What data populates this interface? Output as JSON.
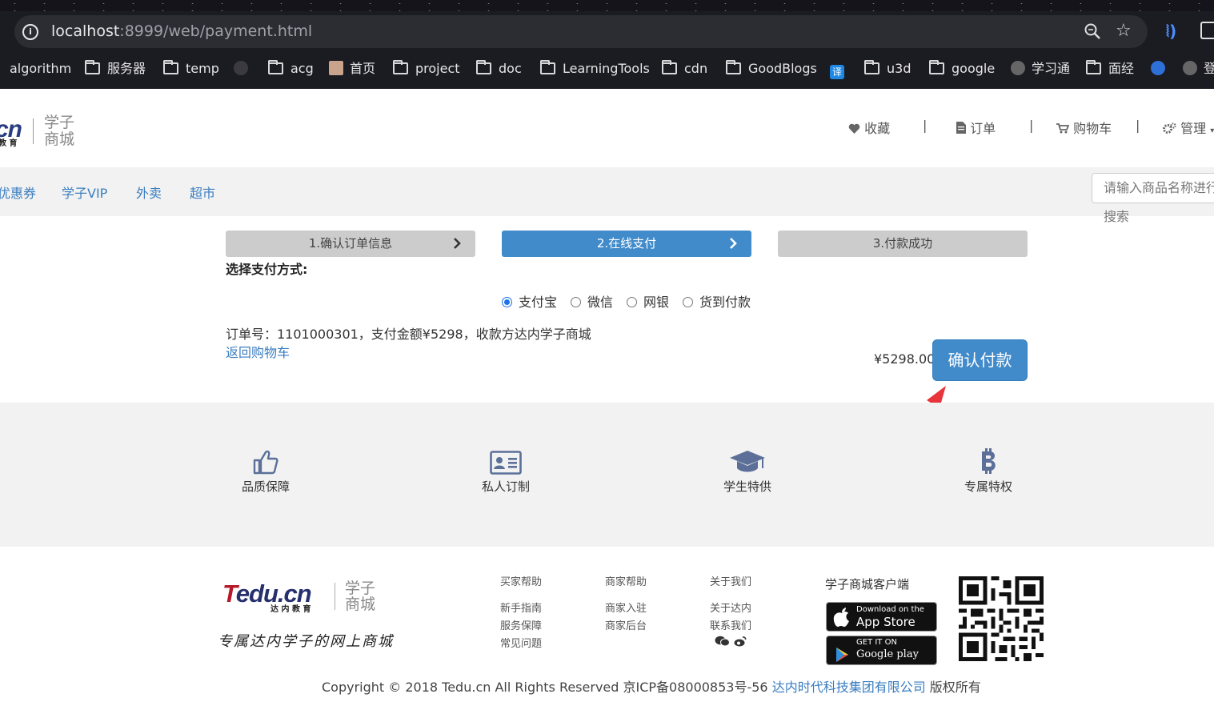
{
  "browser": {
    "url_host": "localhost",
    "url_rest": ":8999/web/payment.html",
    "bookmarks": [
      "algorithm",
      "服务器",
      "temp",
      "acg",
      "首页",
      "project",
      "doc",
      "LearningTools",
      "cdn",
      "GoodBlogs",
      "u3d",
      "google",
      "学习通",
      "面经",
      "登"
    ]
  },
  "header": {
    "logo_cn": "cn",
    "logo_sub": "教 育",
    "logo_text_1": "学子",
    "logo_text_2": "商城",
    "nav": {
      "favorites": "收藏",
      "orders": "订单",
      "cart": "购物车",
      "admin": "管理",
      "separator": "|"
    }
  },
  "categories": [
    "优惠券",
    "学子VIP",
    "外卖",
    "超市"
  ],
  "search": {
    "placeholder": "请输入商品名称进行搜索"
  },
  "steps": [
    {
      "label": "1.确认订单信息",
      "chevron": "›"
    },
    {
      "label": "2.在线支付",
      "chevron": "›"
    },
    {
      "label": "3.付款成功"
    }
  ],
  "payment": {
    "title": "选择支付方式:",
    "methods": [
      "支付宝",
      "微信",
      "网银",
      "货到付款"
    ],
    "selected": "支付宝",
    "order_info": "订单号：1101000301，支付金额¥5298，收款方达内学子商城",
    "back_link": "返回购物车",
    "amount": "¥5298.00",
    "confirm_button": "确认付款",
    "accent_color": "#428bca",
    "annotation_arrow_color": "#e8343a"
  },
  "features": [
    {
      "label": "品质保障",
      "icon": "thumbs-up-icon"
    },
    {
      "label": "私人订制",
      "icon": "id-card-icon"
    },
    {
      "label": "学生特供",
      "icon": "graduation-cap-icon"
    },
    {
      "label": "专属特权",
      "icon": "bitcoin-icon"
    }
  ],
  "footer": {
    "logo_t": "T",
    "logo_rest": "edu.cn",
    "logo_sub": "达 内 教 育",
    "logo_text_1": "学子",
    "logo_text_2": "商城",
    "slogan": "专属达内学子的网上商城",
    "columns": [
      {
        "heading": "买家帮助",
        "items": [
          "新手指南",
          "服务保障",
          "常见问题"
        ]
      },
      {
        "heading": "商家帮助",
        "items": [
          "商家入驻",
          "商家后台"
        ]
      },
      {
        "heading": "关于我们",
        "items": [
          "关于达内",
          "联系我们"
        ]
      }
    ],
    "client_title": "学子商城客户端",
    "app_store_small": "Download on the",
    "app_store_large": "App Store",
    "google_small": "GET IT ON",
    "google_large": "Google play",
    "copyright_text": "Copyright © 2018 Tedu.cn All Rights Reserved 京ICP备08000853号-56 ",
    "copyright_link": "达内时代科技集团有限公司",
    "copyright_suffix": " 版权所有"
  }
}
